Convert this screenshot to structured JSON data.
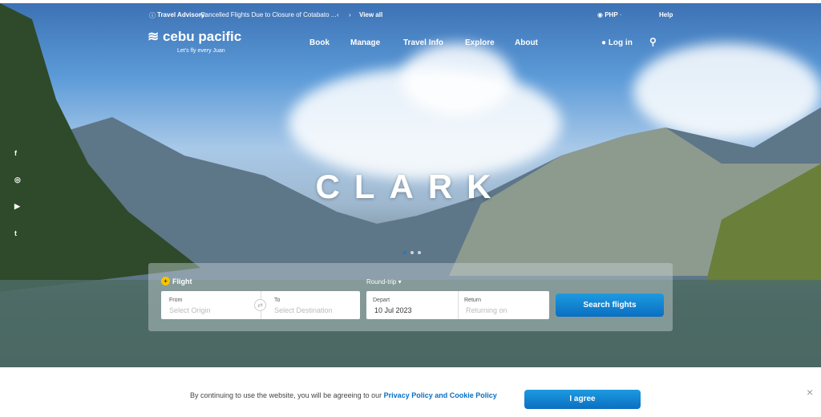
{
  "topbar": {
    "advisory_label": "Travel Advisory:",
    "advisory_text": "Cancelled Flights Due to Closure of Cotabato ...",
    "prev": "‹",
    "next": "›",
    "view_all": "View all",
    "currency": "PHP",
    "help": "Help"
  },
  "brand": {
    "name": "cebu pacific",
    "tagline": "Let's fly every Juan"
  },
  "nav": {
    "items": [
      "Book",
      "Manage",
      "Travel Info",
      "Explore",
      "About"
    ],
    "login": "Log in"
  },
  "social": [
    "f",
    "◎",
    "▶",
    "t"
  ],
  "hero": {
    "destination": "CLARK",
    "slides": 3,
    "active_slide": 1
  },
  "booking": {
    "tab": "Flight",
    "trip_type": "Round-trip",
    "from_label": "From",
    "from_placeholder": "Select Origin",
    "to_label": "To",
    "to_placeholder": "Select Destination",
    "depart_label": "Depart",
    "depart_value": "10 Jul 2023",
    "return_label": "Return",
    "return_placeholder": "Returning on",
    "search": "Search flights"
  },
  "cookie": {
    "text": "By continuing to use the website, you will be agreeing to our",
    "link": "Privacy Policy and Cookie Policy",
    "agree": "I agree",
    "close": "×"
  },
  "colors": {
    "accent": "#0a78c8",
    "brand_yellow": "#f5c400"
  }
}
